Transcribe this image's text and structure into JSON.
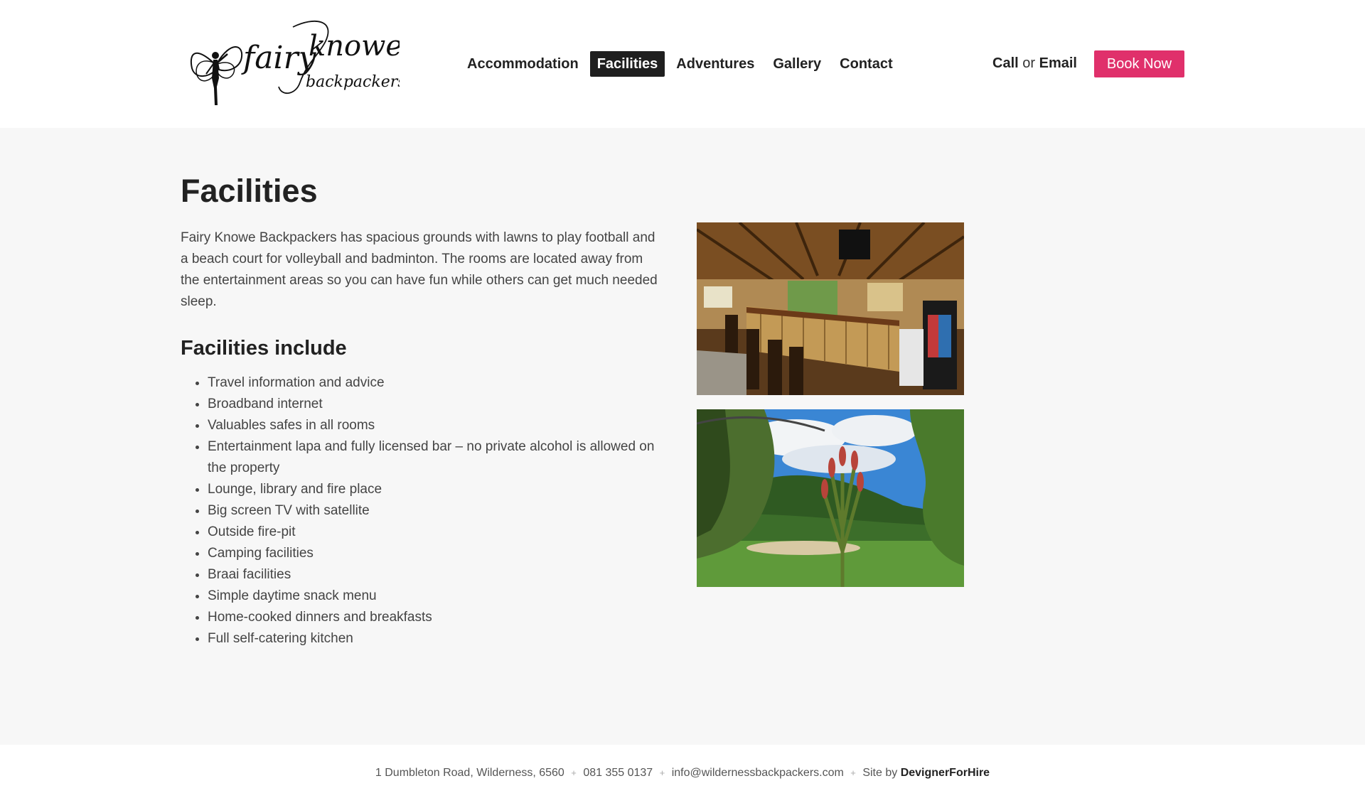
{
  "brand": {
    "logo_main": "fairy knowe",
    "logo_sub": "backpackers"
  },
  "nav": {
    "items": [
      {
        "label": "Accommodation"
      },
      {
        "label": "Facilities",
        "active": true
      },
      {
        "label": "Adventures"
      },
      {
        "label": "Gallery"
      },
      {
        "label": "Contact"
      }
    ]
  },
  "header_actions": {
    "call_label": "Call",
    "or_label": "or",
    "email_label": "Email",
    "book_label": "Book Now",
    "book_color": "#e0306b"
  },
  "main": {
    "title": "Facilities",
    "intro": "Fairy Knowe Backpackers has spacious grounds with lawns to play football and a beach court for volleyball and badminton. The rooms are located away from the entertainment areas so you can have fun while others can get much needed sleep.",
    "subtitle": "Facilities include",
    "facilities": [
      "Travel information and advice",
      "Broadband internet",
      "Valuables safes in all rooms",
      "Entertainment lapa and fully licensed bar – no private alcohol is allowed on the property",
      "Lounge, library and fire place",
      "Big screen TV with satellite",
      "Outside fire-pit",
      "Camping facilities",
      "Braai facilities",
      "Simple daytime snack menu",
      "Home-cooked dinners and breakfasts",
      "Full self-catering kitchen"
    ]
  },
  "footer": {
    "address": "1 Dumbleton Road, Wilderness, 6560",
    "separator": "+",
    "phone": "081 355 0137",
    "email": "info@wildernessbackpackers.com",
    "site_by_label": "Site by",
    "site_by_name": "DevignerForHire"
  }
}
